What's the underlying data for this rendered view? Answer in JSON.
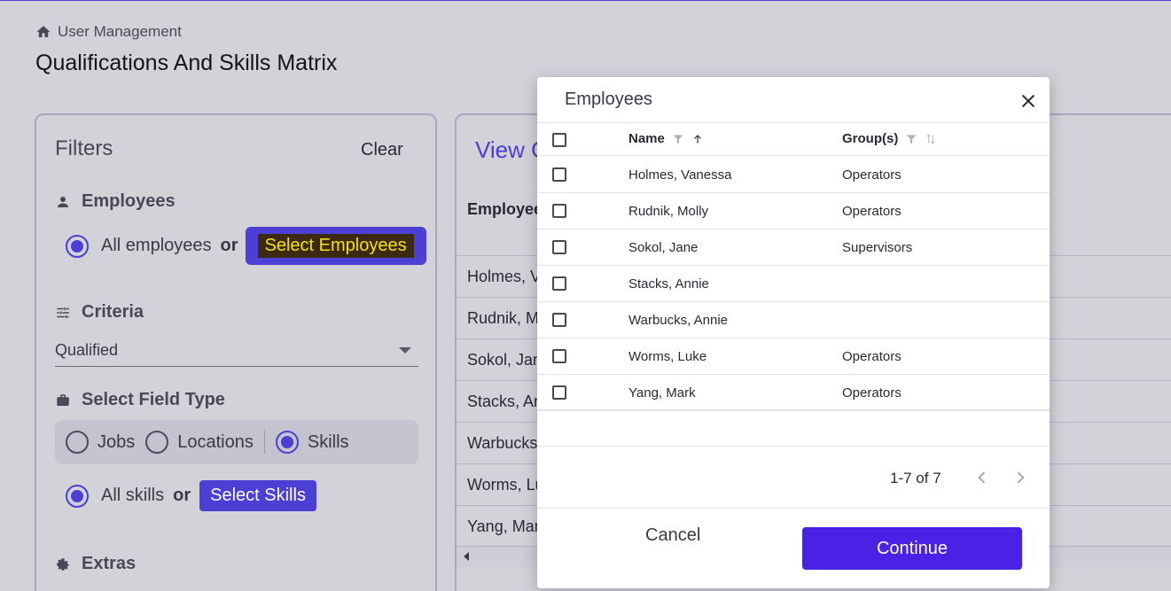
{
  "breadcrumb": {
    "label": "User Management"
  },
  "page": {
    "title": "Qualifications And Skills Matrix"
  },
  "filters": {
    "title": "Filters",
    "clear_label": "Clear",
    "employees": {
      "heading": "Employees",
      "all_label": "All employees",
      "or_label": "or",
      "select_label": "Select Employees"
    },
    "criteria": {
      "heading": "Criteria",
      "selected": "Qualified"
    },
    "field_type": {
      "heading": "Select Field Type",
      "options": [
        "Jobs",
        "Locations",
        "Skills"
      ],
      "selected": "Skills"
    },
    "skills": {
      "all_label": "All skills",
      "or_label": "or",
      "select_label": "Select Skills"
    },
    "extras": {
      "heading": "Extras"
    }
  },
  "view": {
    "title": "View C",
    "column_header": "Employee",
    "rows": [
      "Holmes, V",
      "Rudnik, M",
      "Sokol, Jan",
      "Stacks, An",
      "Warbucks",
      "Worms, Lu",
      "Yang, Mar"
    ]
  },
  "modal": {
    "title": "Employees",
    "columns": {
      "name": "Name",
      "groups": "Group(s)"
    },
    "rows": [
      {
        "name": "Holmes, Vanessa",
        "group": "Operators"
      },
      {
        "name": "Rudnik, Molly",
        "group": "Operators"
      },
      {
        "name": "Sokol, Jane",
        "group": "Supervisors"
      },
      {
        "name": "Stacks, Annie",
        "group": ""
      },
      {
        "name": "Warbucks, Annie",
        "group": ""
      },
      {
        "name": "Worms, Luke",
        "group": "Operators"
      },
      {
        "name": "Yang, Mark",
        "group": "Operators"
      }
    ],
    "pagination": "1-7 of 7",
    "cancel_label": "Cancel",
    "continue_label": "Continue"
  },
  "colors": {
    "accent": "#4b3fd6",
    "continue": "#4b21e6",
    "focus_highlight": "#f4e400"
  }
}
